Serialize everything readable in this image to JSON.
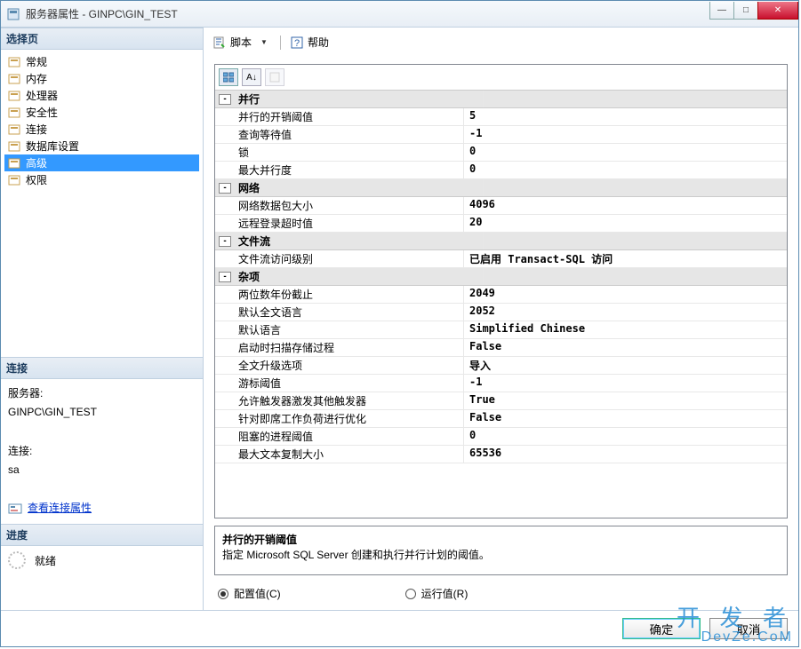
{
  "window": {
    "title": "服务器属性 - GINPC\\GIN_TEST"
  },
  "sidebar": {
    "select_page": "选择页",
    "items": [
      {
        "label": "常规"
      },
      {
        "label": "内存"
      },
      {
        "label": "处理器"
      },
      {
        "label": "安全性"
      },
      {
        "label": "连接"
      },
      {
        "label": "数据库设置"
      },
      {
        "label": "高级",
        "selected": true
      },
      {
        "label": "权限"
      }
    ],
    "connection_header": "连接",
    "server_label": "服务器:",
    "server_value": "GINPC\\GIN_TEST",
    "conn_label": "连接:",
    "conn_value": "sa",
    "view_conn_link": "查看连接属性",
    "progress_header": "进度",
    "ready": "就绪"
  },
  "toolbar": {
    "script": "脚本",
    "help": "帮助"
  },
  "property_categories": [
    {
      "name": "并行",
      "rows": [
        {
          "name": "并行的开销阈值",
          "value": "5"
        },
        {
          "name": "查询等待值",
          "value": "-1"
        },
        {
          "name": "锁",
          "value": "0"
        },
        {
          "name": "最大并行度",
          "value": "0"
        }
      ]
    },
    {
      "name": "网络",
      "rows": [
        {
          "name": "网络数据包大小",
          "value": "4096"
        },
        {
          "name": "远程登录超时值",
          "value": "20"
        }
      ]
    },
    {
      "name": "文件流",
      "rows": [
        {
          "name": "文件流访问级别",
          "value": "已启用 Transact-SQL 访问"
        }
      ]
    },
    {
      "name": "杂项",
      "rows": [
        {
          "name": "两位数年份截止",
          "value": "2049"
        },
        {
          "name": "默认全文语言",
          "value": "2052"
        },
        {
          "name": "默认语言",
          "value": "Simplified Chinese"
        },
        {
          "name": "启动时扫描存储过程",
          "value": "False"
        },
        {
          "name": "全文升级选项",
          "value": "导入"
        },
        {
          "name": "游标阈值",
          "value": "-1"
        },
        {
          "name": "允许触发器激发其他触发器",
          "value": "True"
        },
        {
          "name": "针对即席工作负荷进行优化",
          "value": "False"
        },
        {
          "name": "阻塞的进程阈值",
          "value": "0"
        },
        {
          "name": "最大文本复制大小",
          "value": "65536"
        }
      ]
    }
  ],
  "description": {
    "title": "并行的开销阈值",
    "text": "指定 Microsoft SQL Server 创建和执行并行计划的阈值。"
  },
  "radios": {
    "configured": "配置值(C)",
    "running": "运行值(R)"
  },
  "buttons": {
    "ok": "确定",
    "cancel": "取消"
  },
  "watermark": {
    "line1": "开 发 者",
    "line2": "DevZe.CoM"
  }
}
